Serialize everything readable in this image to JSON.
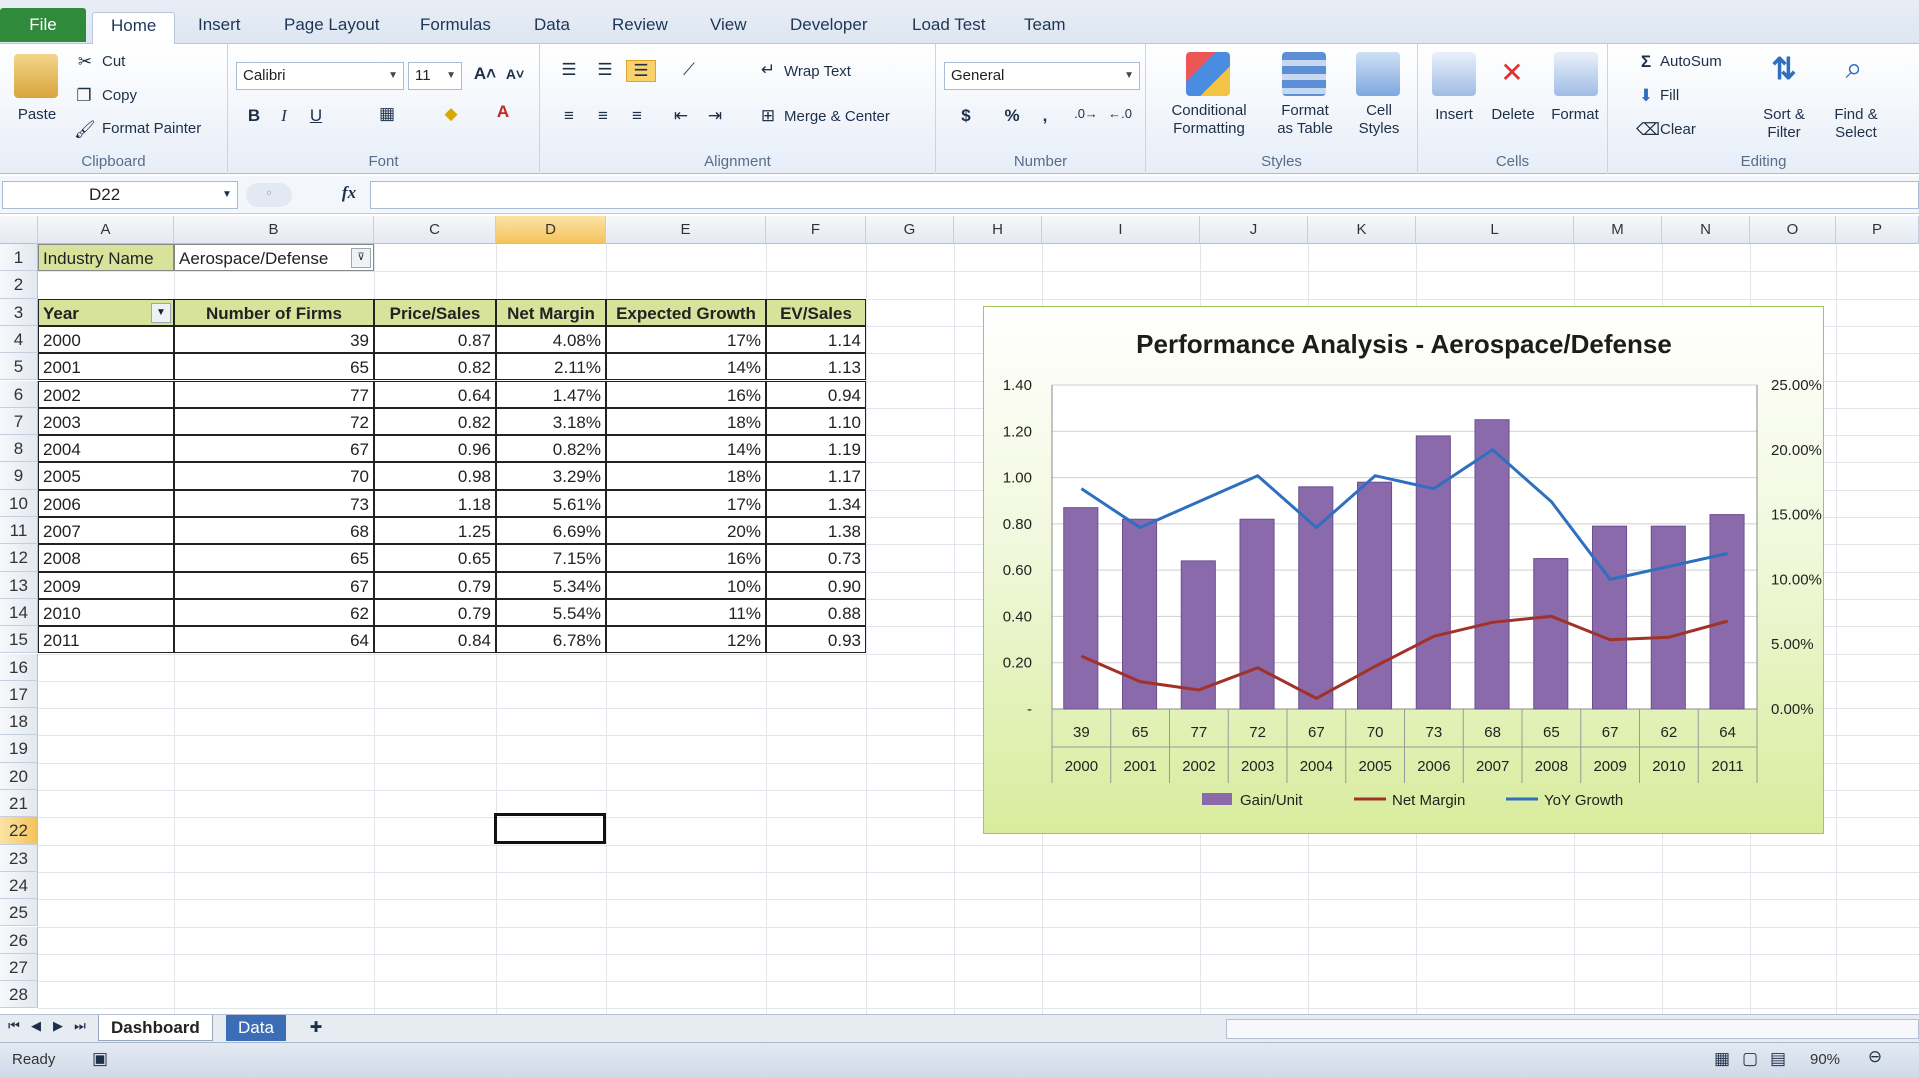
{
  "ribbon_tabs": [
    "File",
    "Home",
    "Insert",
    "Page Layout",
    "Formulas",
    "Data",
    "Review",
    "View",
    "Developer",
    "Load Test",
    "Team"
  ],
  "clipboard": {
    "paste": "Paste",
    "cut": "Cut",
    "copy": "Copy",
    "format_painter": "Format Painter",
    "label": "Clipboard"
  },
  "font": {
    "name": "Calibri",
    "size": "11",
    "label": "Font",
    "bold": "B",
    "italic": "I",
    "underline": "U"
  },
  "alignment": {
    "wrap_text": "Wrap Text",
    "merge_center": "Merge & Center",
    "label": "Alignment"
  },
  "number": {
    "format": "General",
    "currency": "$",
    "percent": "%",
    "comma": ",",
    "label": "Number"
  },
  "styles": {
    "conditional": "Conditional\nFormatting",
    "format_table": "Format\nas Table",
    "cell_styles": "Cell\nStyles",
    "label": "Styles"
  },
  "cells": {
    "insert": "Insert",
    "delete": "Delete",
    "format": "Format",
    "label": "Cells"
  },
  "editing": {
    "autosum": "AutoSum",
    "fill": "Fill",
    "clear": "Clear",
    "sort_filter": "Sort &\nFilter",
    "find_select": "Find &\nSelect",
    "label": "Editing"
  },
  "formula_bar": {
    "name_box": "D22",
    "fx": "fx",
    "formula": ""
  },
  "columns": [
    "A",
    "B",
    "C",
    "D",
    "E",
    "F",
    "G",
    "H",
    "I",
    "J",
    "K",
    "L",
    "M",
    "N",
    "O",
    "P"
  ],
  "rows": [
    "1",
    "2",
    "3",
    "4",
    "5",
    "6",
    "7",
    "8",
    "9",
    "10",
    "11",
    "12",
    "13",
    "14",
    "15",
    "16",
    "17",
    "18",
    "19",
    "20",
    "21",
    "22",
    "23",
    "24",
    "25",
    "26",
    "27",
    "28"
  ],
  "filter": {
    "label": "Industry Name",
    "value": "Aerospace/Defense"
  },
  "table": {
    "headers": [
      "Year",
      "Number of Firms",
      "Price/Sales",
      "Net Margin",
      "Expected Growth",
      "EV/Sales"
    ],
    "rows": [
      [
        "2000",
        "39",
        "0.87",
        "4.08%",
        "17%",
        "1.14"
      ],
      [
        "2001",
        "65",
        "0.82",
        "2.11%",
        "14%",
        "1.13"
      ],
      [
        "2002",
        "77",
        "0.64",
        "1.47%",
        "16%",
        "0.94"
      ],
      [
        "2003",
        "72",
        "0.82",
        "3.18%",
        "18%",
        "1.10"
      ],
      [
        "2004",
        "67",
        "0.96",
        "0.82%",
        "14%",
        "1.19"
      ],
      [
        "2005",
        "70",
        "0.98",
        "3.29%",
        "18%",
        "1.17"
      ],
      [
        "2006",
        "73",
        "1.18",
        "5.61%",
        "17%",
        "1.34"
      ],
      [
        "2007",
        "68",
        "1.25",
        "6.69%",
        "20%",
        "1.38"
      ],
      [
        "2008",
        "65",
        "0.65",
        "7.15%",
        "16%",
        "0.73"
      ],
      [
        "2009",
        "67",
        "0.79",
        "5.34%",
        "10%",
        "0.90"
      ],
      [
        "2010",
        "62",
        "0.79",
        "5.54%",
        "11%",
        "0.88"
      ],
      [
        "2011",
        "64",
        "0.84",
        "6.78%",
        "12%",
        "0.93"
      ]
    ]
  },
  "chart_data": {
    "type": "bar",
    "title": "Performance Analysis - Aerospace/Defense",
    "categories": [
      "2000",
      "2001",
      "2002",
      "2003",
      "2004",
      "2005",
      "2006",
      "2007",
      "2008",
      "2009",
      "2010",
      "2011"
    ],
    "firm_labels": [
      "39",
      "65",
      "77",
      "72",
      "67",
      "70",
      "73",
      "68",
      "65",
      "67",
      "62",
      "64"
    ],
    "series": [
      {
        "name": "Gain/Unit",
        "kind": "bar",
        "axis": "left",
        "color": "#8a6aab",
        "values": [
          0.87,
          0.82,
          0.64,
          0.82,
          0.96,
          0.98,
          1.18,
          1.25,
          0.65,
          0.79,
          0.79,
          0.84
        ]
      },
      {
        "name": "Net Margin",
        "kind": "line",
        "axis": "right",
        "color": "#a0322a",
        "values": [
          4.08,
          2.11,
          1.47,
          3.18,
          0.82,
          3.29,
          5.61,
          6.69,
          7.15,
          5.34,
          5.54,
          6.78
        ]
      },
      {
        "name": "YoY Growth",
        "kind": "line",
        "axis": "right",
        "color": "#2f6fbf",
        "values": [
          17,
          14,
          16,
          18,
          14,
          18,
          17,
          20,
          16,
          10,
          11,
          12
        ]
      }
    ],
    "ylim_left": [
      0,
      1.4
    ],
    "yticks_left": [
      "-",
      "0.20",
      "0.40",
      "0.60",
      "0.80",
      "1.00",
      "1.20",
      "1.40"
    ],
    "ylim_right": [
      0,
      25
    ],
    "yticks_right": [
      "0.00%",
      "5.00%",
      "10.00%",
      "15.00%",
      "20.00%",
      "25.00%"
    ],
    "legend_position": "bottom",
    "grid": true
  },
  "sheets": {
    "active": "Dashboard",
    "other": "Data"
  },
  "status": {
    "ready": "Ready",
    "zoom": "90%"
  }
}
